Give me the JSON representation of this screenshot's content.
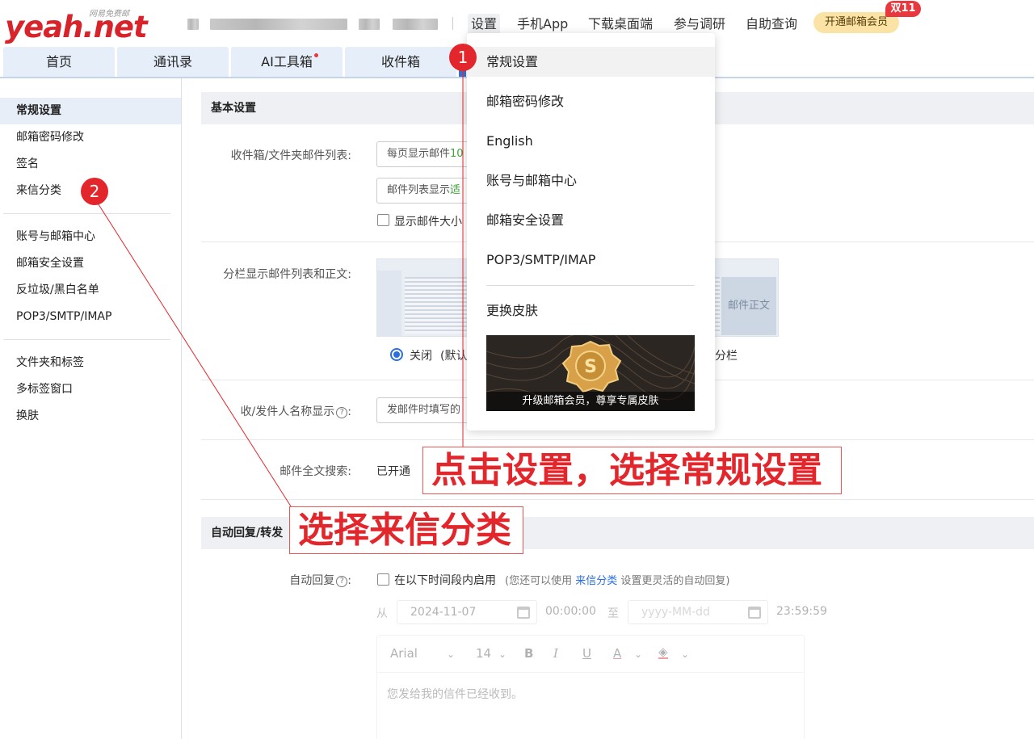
{
  "header": {
    "logo": "yeah.net",
    "logo_tagline": "网易免费邮",
    "top_nav": [
      "设置",
      "手机App",
      "下载桌面端",
      "参与调研",
      "自助查询"
    ],
    "vip_button": "开通邮箱会员",
    "promo_badge": "双11"
  },
  "tabs": [
    "首页",
    "通讯录",
    "AI工具箱",
    "收件箱"
  ],
  "sidebar": {
    "group1": [
      "常规设置",
      "邮箱密码修改",
      "签名",
      "来信分类"
    ],
    "group2": [
      "账号与邮箱中心",
      "邮箱安全设置",
      "反垃圾/黑白名单",
      "POP3/SMTP/IMAP"
    ],
    "group3": [
      "文件夹和标签",
      "多标签窗口",
      "换肤"
    ]
  },
  "basic_settings": {
    "title": "基本设置",
    "list_label": "收件箱/文件夹邮件列表:",
    "per_page_prefix": "每页显示邮件",
    "per_page_value": "10",
    "list_display_prefix": "邮件列表显示",
    "list_display_value": "适",
    "show_size": "显示邮件大小",
    "split_label": "分栏显示邮件列表和正文:",
    "preview_body": "邮件正文",
    "radio_off": "关闭",
    "radio_off_hint": "(默认",
    "radio_split_partial": "分栏",
    "sender_label": "收/发件人名称显示",
    "sender_value": "发邮件时填写的",
    "search_label": "邮件全文搜索:",
    "search_value": "已开通"
  },
  "auto_reply": {
    "title": "自动回复/转发",
    "label": "自动回复",
    "enable_text": "在以下时间段内启用",
    "hint_prefix": "(您还可以使用",
    "hint_link": "来信分类",
    "hint_suffix": "设置更灵活的自动回复)",
    "from": "从",
    "start_date": "2024-11-07",
    "start_time": "00:00:00",
    "to": "至",
    "end_date_placeholder": "yyyy-MM-dd",
    "end_time": "23:59:59",
    "font": "Arial",
    "font_size": "14",
    "reply_text": "您发给我的信件已经收到。"
  },
  "dropdown": {
    "items": [
      "常规设置",
      "邮箱密码修改",
      "English",
      "账号与邮箱中心",
      "邮箱安全设置",
      "POP3/SMTP/IMAP"
    ],
    "skin_item": "更换皮肤",
    "banner_caption": "升级邮箱会员，尊享专属皮肤"
  },
  "annotations": {
    "step1": "1",
    "step2": "2",
    "callout1": "点击设置，选择常规设置",
    "callout2": "选择来信分类"
  },
  "colors": {
    "brand_red": "#d8232a",
    "annotation_red": "#e3262b",
    "link_blue": "#2a6ee0",
    "tab_bg": "#e6eef9"
  }
}
